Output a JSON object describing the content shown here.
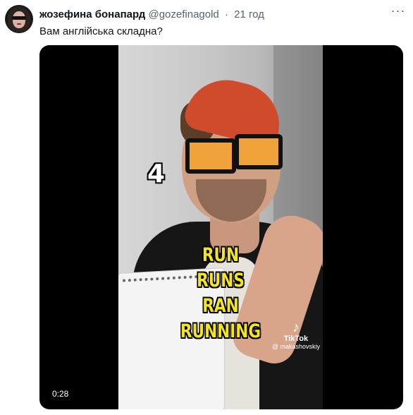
{
  "tweet": {
    "author_name": "жозефина бонапард",
    "handle": "@gozefinagold",
    "separator": "·",
    "time": "21 год",
    "more_icon": "more-dots-icon",
    "text": "Вам англійська складна?"
  },
  "video": {
    "overlay_number": "4",
    "overlay_words": [
      "RUN",
      "RUNS",
      "RAN",
      "RUNNING"
    ],
    "overlay_color": "#f5e51c",
    "watermark_brand": "TikTok",
    "watermark_user": "@ makashovskiy",
    "duration": "0:28"
  },
  "colors": {
    "text_primary": "#0f1419",
    "text_secondary": "#536471",
    "media_bg": "#000000"
  }
}
